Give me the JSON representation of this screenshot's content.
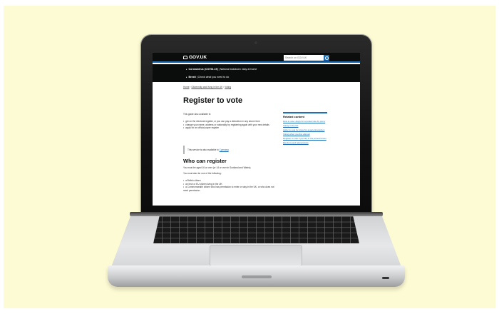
{
  "site": {
    "brand": "GOV.UK",
    "search_placeholder": "Search on GOV.UK",
    "banner": {
      "line1_bold": "Coronavirus (COVID-19)",
      "line1_rest": "National lockdown: stay at home",
      "line2_bold": "Brexit",
      "line2_rest": "Check what you need to do"
    },
    "breadcrumb": [
      "Home",
      "Citizenship and living in the UK",
      "Voting"
    ],
    "title": "Register to vote",
    "intro": "This guide also available in:",
    "bullets": [
      "get on the electoral register, or you can pay a deduction in any above form",
      "change your name, address or nationality by registering again with your new details",
      "apply for an official paper register"
    ],
    "inset_text": "This service is also available in",
    "inset_link": "Cymraeg",
    "section_title": "Who can register",
    "section_p1": "You must be aged 16 or over (or 14 or over in Scotland and Wales).",
    "section_p2": "You must also be one of the following:",
    "section_bullets": [
      "a British citizen",
      "an Irish or EU citizen living in the UK",
      "a Commonwealth citizen who has permission to enter or stay in the UK, or who does not need permission"
    ],
    "related": {
      "title": "Related content",
      "links": [
        "How to vote: Apply for a postal vote by proxy",
        "Voting in the UK",
        "Apply to vote by proxy for a general election",
        "Voting when you live abroad",
        "Register to vote if you are in the armed forces",
        "Elections and referendums"
      ]
    }
  }
}
